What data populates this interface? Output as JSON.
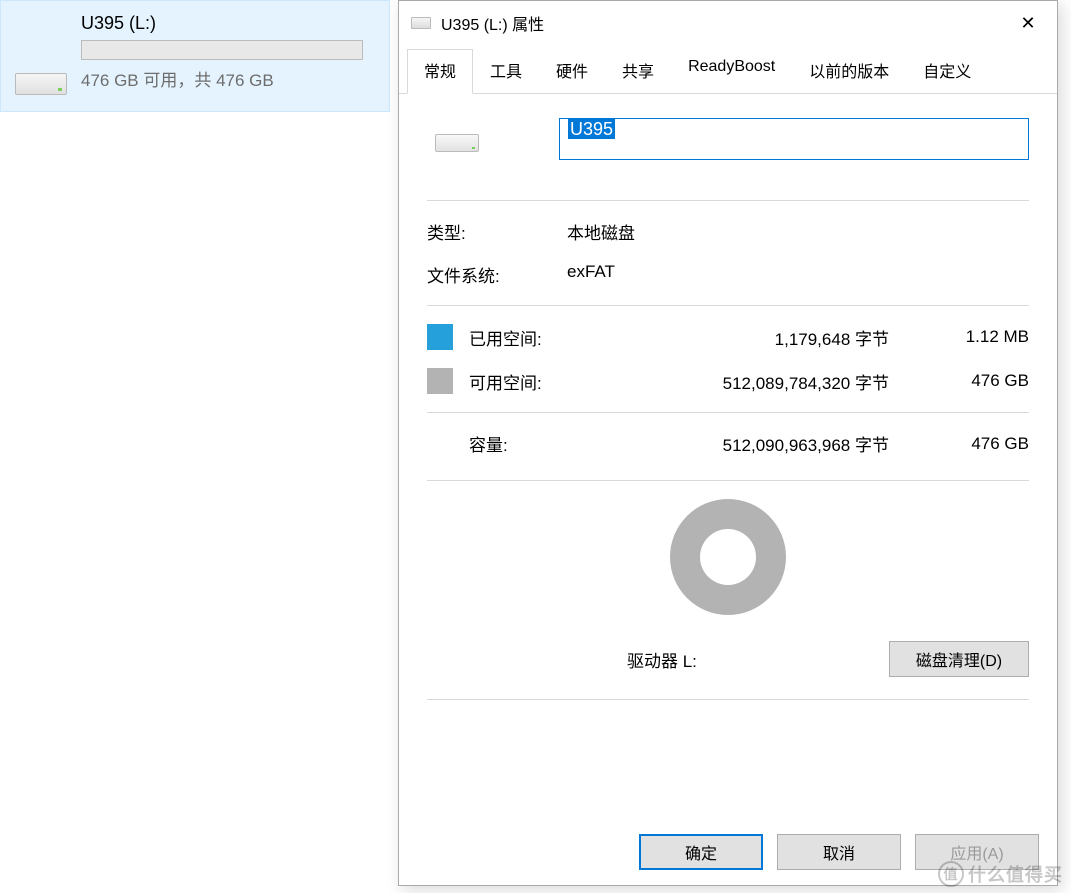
{
  "explorer": {
    "drive_title": "U395 (L:)",
    "drive_subtitle": "476 GB 可用，共 476 GB"
  },
  "dialog": {
    "title": "U395 (L:) 属性",
    "close_glyph": "✕",
    "tabs": [
      "常规",
      "工具",
      "硬件",
      "共享",
      "ReadyBoost",
      "以前的版本",
      "自定义"
    ],
    "active_tab": 0,
    "name_value": "U395",
    "type_label": "类型:",
    "type_value": "本地磁盘",
    "fs_label": "文件系统:",
    "fs_value": "exFAT",
    "used_label": "已用空间:",
    "used_bytes": "1,179,648 字节",
    "used_hr": "1.12 MB",
    "free_label": "可用空间:",
    "free_bytes": "512,089,784,320 字节",
    "free_hr": "476 GB",
    "capacity_label": "容量:",
    "capacity_bytes": "512,090,963,968 字节",
    "capacity_hr": "476 GB",
    "drive_letter_label": "驱动器 L:",
    "cleanup_label": "磁盘清理(D)",
    "ok_label": "确定",
    "cancel_label": "取消",
    "apply_label": "应用(A)"
  },
  "chart_data": {
    "type": "pie",
    "title": "驱动器 L:",
    "series": [
      {
        "name": "已用空间",
        "value": 1179648,
        "color": "#26a0da"
      },
      {
        "name": "可用空间",
        "value": 512089784320,
        "color": "#b3b3b3"
      }
    ]
  },
  "watermark": {
    "symbol": "值",
    "text": "什么值得买"
  }
}
